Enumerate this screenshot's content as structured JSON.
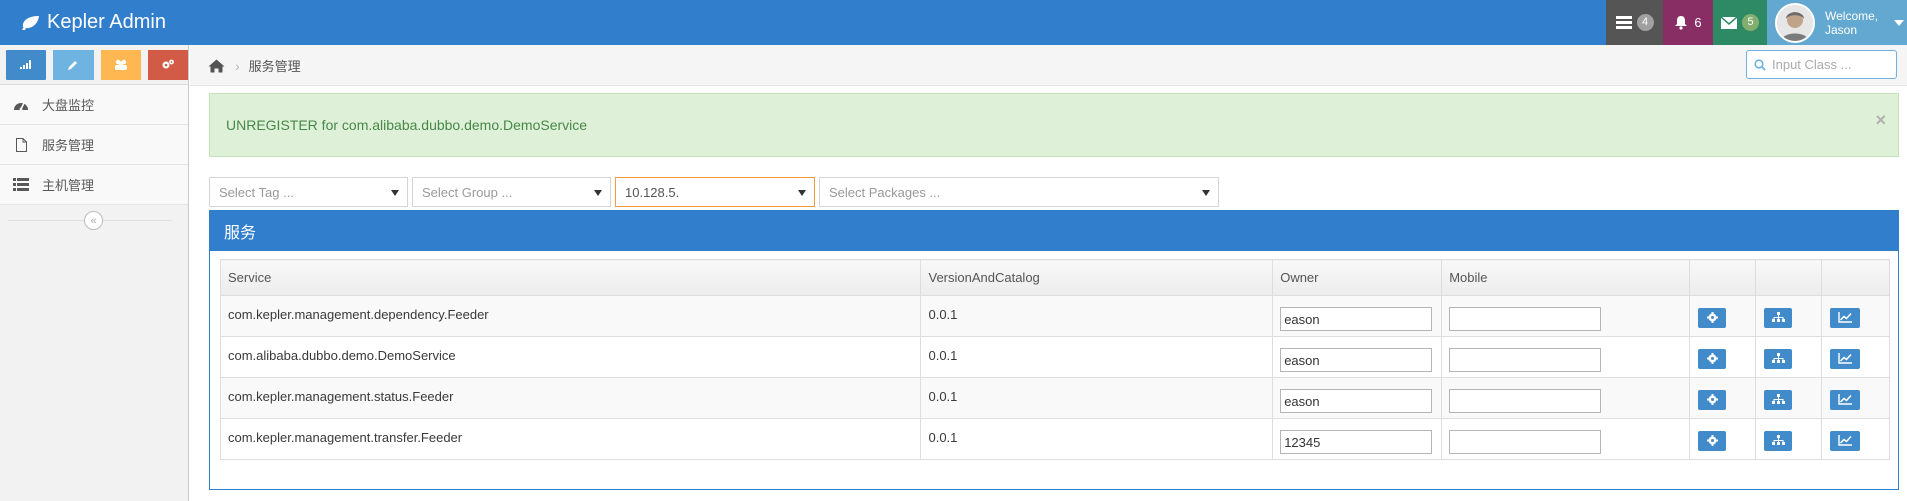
{
  "navbar": {
    "brand": "Kepler Admin",
    "tasks_count": "4",
    "notifications_count": "6",
    "messages_count": "5",
    "welcome": "Welcome,",
    "username": "Jason"
  },
  "sidebar": {
    "items": [
      {
        "label": "大盘监控",
        "icon": "dashboard-icon"
      },
      {
        "label": "服务管理",
        "icon": "file-icon"
      },
      {
        "label": "主机管理",
        "icon": "list-icon"
      }
    ]
  },
  "breadcrumb": {
    "current": "服务管理"
  },
  "search": {
    "placeholder": "Input Class ..."
  },
  "alert": {
    "text": "UNREGISTER for com.alibaba.dubbo.demo.DemoService",
    "close": "×"
  },
  "filters": {
    "tag": "Select Tag ...",
    "group": "Select Group ...",
    "host": "10.128.5.",
    "packages": "Select Packages ..."
  },
  "widget": {
    "title": "服务"
  },
  "table": {
    "headers": [
      "Service",
      "VersionAndCatalog",
      "Owner",
      "Mobile",
      "",
      "",
      ""
    ],
    "rows": [
      {
        "service": "com.kepler.management.dependency.Feeder",
        "version": "0.0.1",
        "owner": "eason",
        "mobile": ""
      },
      {
        "service": "com.alibaba.dubbo.demo.DemoService",
        "version": "0.0.1",
        "owner": "eason",
        "mobile": ""
      },
      {
        "service": "com.kepler.management.status.Feeder",
        "version": "0.0.1",
        "owner": "eason",
        "mobile": ""
      },
      {
        "service": "com.kepler.management.transfer.Feeder",
        "version": "0.0.1",
        "owner": "12345",
        "mobile": ""
      }
    ]
  },
  "colors": {
    "navbar": "#307ecc",
    "alert_bg": "#dff0d8",
    "alert_text": "#468847",
    "action_button": "#428bca"
  }
}
